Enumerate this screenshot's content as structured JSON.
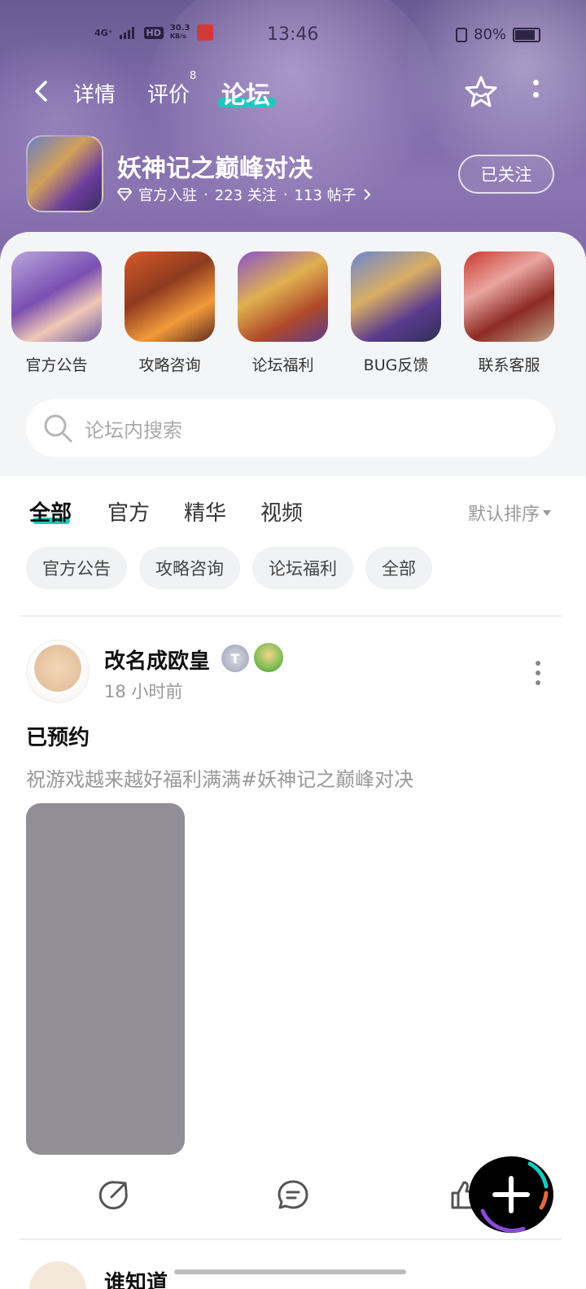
{
  "status_bar": {
    "network": "4G⁺",
    "hd": "HD",
    "speed": "30.3",
    "speed_unit": "KB/s",
    "time": "13:46",
    "battery": "80%"
  },
  "nav": {
    "tabs": [
      {
        "label": "详情"
      },
      {
        "label": "评价",
        "badge": "8"
      },
      {
        "label": "论坛"
      }
    ]
  },
  "game": {
    "title": "妖神记之巅峰对决",
    "official": "官方入驻",
    "followers": "223 关注",
    "posts": "113 帖子",
    "follow_label": "已关注"
  },
  "categories": [
    {
      "label": "官方公告"
    },
    {
      "label": "攻略咨询"
    },
    {
      "label": "论坛福利"
    },
    {
      "label": "BUG反馈"
    },
    {
      "label": "联系客服"
    }
  ],
  "search": {
    "placeholder": "论坛内搜索"
  },
  "filter": {
    "tabs": [
      "全部",
      "官方",
      "精华",
      "视频"
    ],
    "sort_label": "默认排序"
  },
  "chips": [
    "官方公告",
    "攻略咨询",
    "论坛福利",
    "全部"
  ],
  "post": {
    "username": "改名成欧皇",
    "level_badge": "T",
    "time": "18 小时前",
    "title": "已预约",
    "body": "祝游戏越来越好福利满满#妖神记之巅峰对决"
  },
  "next_post": {
    "username": "谁知道"
  },
  "colors": {
    "accent": "#1ec8c0",
    "banner": "#7d6aa8",
    "image_placeholder": "#918e95"
  }
}
